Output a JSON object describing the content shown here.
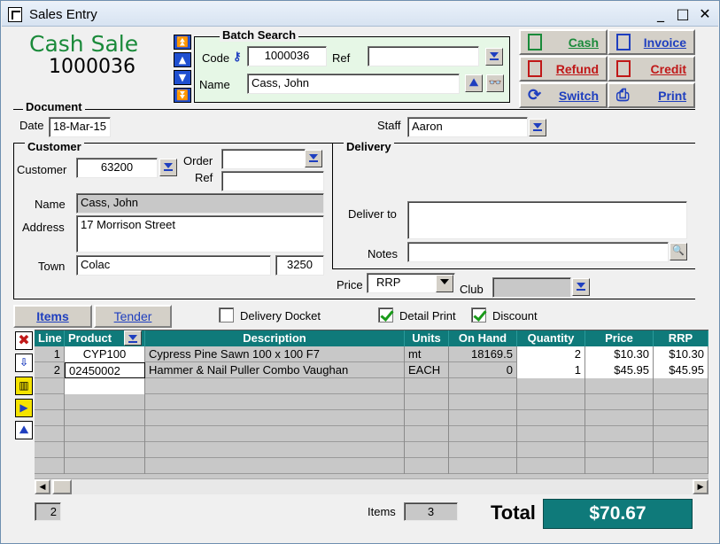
{
  "window": {
    "title": "Sales Entry",
    "min": "_",
    "max": "□",
    "close": "✕"
  },
  "header": {
    "mode": "Cash Sale",
    "number": "1000036"
  },
  "batch_search": {
    "title": "Batch Search",
    "code_label": "Code",
    "code_value": "1000036",
    "ref_label": "Ref",
    "ref_value": "",
    "name_label": "Name",
    "name_value": "Cass, John"
  },
  "actions": {
    "cash": "Cash",
    "invoice": "Invoice",
    "refund": "Refund",
    "credit": "Credit",
    "switch": "Switch",
    "print": "Print"
  },
  "document": {
    "title": "Document",
    "date_label": "Date",
    "date_value": "18-Mar-15",
    "staff_label": "Staff",
    "staff_value": "Aaron"
  },
  "customer": {
    "title": "Customer",
    "customer_label": "Customer",
    "customer_value": "63200",
    "order_label": "Order",
    "order_value": "",
    "ref_label": "Ref",
    "ref_value": "",
    "name_label": "Name",
    "name_value": "Cass, John",
    "address_label": "Address",
    "address_value": "17 Morrison Street",
    "town_label": "Town",
    "town_value": "Colac",
    "postcode": "3250"
  },
  "delivery": {
    "title": "Delivery",
    "deliver_to_label": "Deliver to",
    "deliver_to_value": "",
    "notes_label": "Notes",
    "notes_value": ""
  },
  "pricing": {
    "price_label": "Price",
    "price_value": "RRP",
    "club_label": "Club",
    "club_value": ""
  },
  "tabs": {
    "items": "Items",
    "tender": "Tender"
  },
  "options": {
    "delivery_docket": {
      "label": "Delivery Docket",
      "checked": false
    },
    "detail_print": {
      "label": "Detail Print",
      "checked": true
    },
    "discount": {
      "label": "Discount",
      "checked": true
    }
  },
  "grid": {
    "headers": [
      "Line",
      "Product",
      "Description",
      "Units",
      "On Hand",
      "Quantity",
      "Price",
      "RRP"
    ],
    "rows": [
      {
        "line": "1",
        "product": "CYP100",
        "description": "Cypress Pine Sawn 100 x 100 F7",
        "units": "mt",
        "on_hand": "18169.5",
        "quantity": "2",
        "price": "$10.30",
        "rrp": "$10.30"
      },
      {
        "line": "2",
        "product": "02450002",
        "description": "Hammer & Nail Puller Combo Vaughan",
        "units": "EACH",
        "on_hand": "0",
        "quantity": "1",
        "price": "$45.95",
        "rrp": "$45.95"
      }
    ]
  },
  "footer": {
    "line_count": "2",
    "items_label": "Items",
    "items_value": "3",
    "total_label": "Total",
    "total_value": "$70.67"
  },
  "colors": {
    "accent_teal": "#0f7a7a",
    "cash_green": "#1a8a3a",
    "refund_red": "#c01818",
    "nav_blue": "#1f4fd0"
  }
}
